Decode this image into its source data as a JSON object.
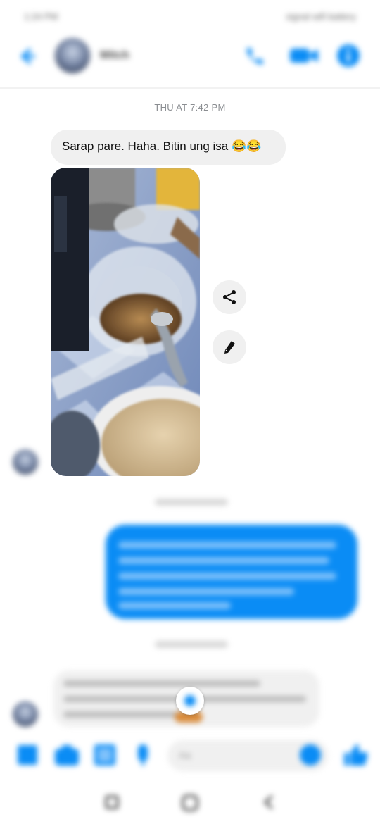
{
  "status_bar": {
    "time": "1:24 PM",
    "icons": "signal wifi battery"
  },
  "header": {
    "contact_name": "Mitch"
  },
  "conversation": {
    "timestamp_1": "THU AT 7:42 PM",
    "message_1": "Sarap pare. Haha. Bitin ung isa 😂😂",
    "timestamp_2": "",
    "timestamp_3": ""
  },
  "composer": {
    "placeholder": "Aa"
  },
  "colors": {
    "accent": "#0a8cf5",
    "bubble_in": "#f0f0f0"
  },
  "icons": [
    "back-arrow-icon",
    "phone-icon",
    "video-icon",
    "info-icon",
    "share-icon",
    "edit-icon",
    "menu-icon",
    "camera-icon",
    "gallery-icon",
    "mic-icon",
    "emoji-icon",
    "thumbs-up-icon"
  ]
}
